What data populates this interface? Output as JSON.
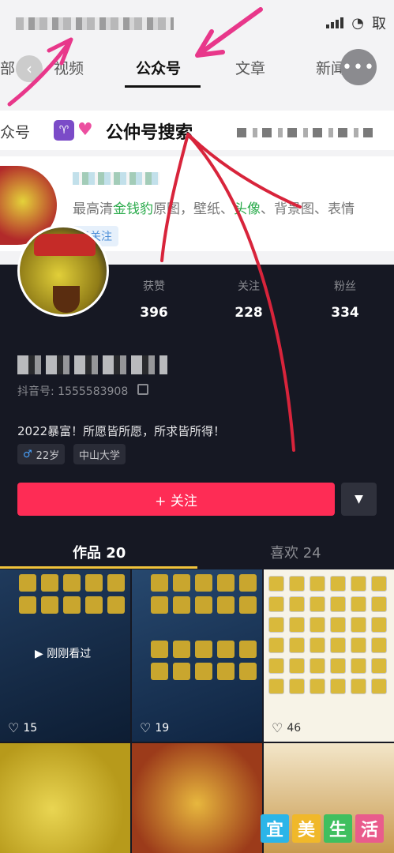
{
  "search_tabs": {
    "items": [
      {
        "label": "视频"
      },
      {
        "label": "公众号"
      },
      {
        "label": "文章"
      },
      {
        "label": "新闻"
      }
    ],
    "partial_left": "部"
  },
  "status_bar": {
    "right_text": "取"
  },
  "search_row": {
    "left_label": "众号",
    "emoji_text": "♈",
    "query": "公仲号搜索"
  },
  "result": {
    "desc_prefix": "最高清",
    "desc_hl1": "金钱豹",
    "desc_mid1": "原图，壁纸、",
    "desc_hl2": "头像",
    "desc_mid2": "、背景图、表情",
    "followed": "已关注"
  },
  "profile": {
    "stats": [
      {
        "label": "获赞",
        "value": "396"
      },
      {
        "label": "关注",
        "value": "228"
      },
      {
        "label": "粉丝",
        "value": "334"
      }
    ],
    "douyin_id": "抖音号: 1555583908",
    "bio": "2022暴富！所愿皆所愿，所求皆所得！",
    "chips": [
      {
        "icon": "♂",
        "text": "22岁"
      },
      {
        "icon": "",
        "text": "中山大学"
      }
    ],
    "follow_label": "+ 关注",
    "dropdown_icon": "▼"
  },
  "profile_tabs": [
    {
      "label": "作品 20"
    },
    {
      "label": "喜欢 24"
    }
  ],
  "videos": [
    {
      "likes": "15",
      "overlay": "▶ 刚刚看过"
    },
    {
      "likes": "19"
    },
    {
      "likes": "46"
    }
  ],
  "watermark": [
    "宜",
    "美",
    "生",
    "活"
  ],
  "colors": {
    "accent_red": "#fe2c55",
    "tab_underline": "#f0c33c",
    "dark_bg": "#161823",
    "highlight_green": "#2bab4c",
    "annotation_red": "#d8243b",
    "annotation_pink": "#e8378a",
    "watermark": [
      "#2bb5e8",
      "#f0b82a",
      "#3fbf5f",
      "#e95c8c"
    ]
  }
}
